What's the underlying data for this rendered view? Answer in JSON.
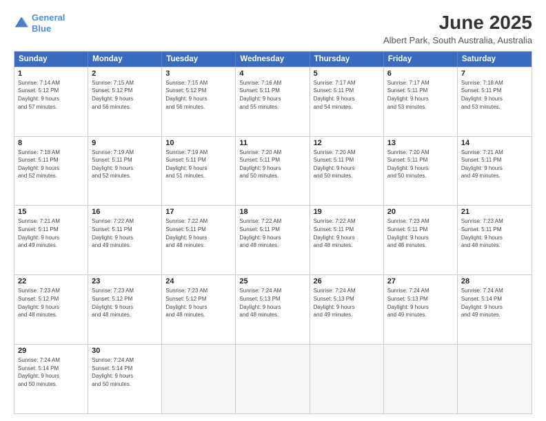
{
  "header": {
    "logo_line1": "General",
    "logo_line2": "Blue",
    "month": "June 2025",
    "location": "Albert Park, South Australia, Australia"
  },
  "days_of_week": [
    "Sunday",
    "Monday",
    "Tuesday",
    "Wednesday",
    "Thursday",
    "Friday",
    "Saturday"
  ],
  "weeks": [
    [
      {
        "day": "1",
        "info": "Sunrise: 7:14 AM\nSunset: 5:12 PM\nDaylight: 9 hours\nand 57 minutes."
      },
      {
        "day": "2",
        "info": "Sunrise: 7:15 AM\nSunset: 5:12 PM\nDaylight: 9 hours\nand 56 minutes."
      },
      {
        "day": "3",
        "info": "Sunrise: 7:15 AM\nSunset: 5:12 PM\nDaylight: 9 hours\nand 56 minutes."
      },
      {
        "day": "4",
        "info": "Sunrise: 7:16 AM\nSunset: 5:11 PM\nDaylight: 9 hours\nand 55 minutes."
      },
      {
        "day": "5",
        "info": "Sunrise: 7:17 AM\nSunset: 5:11 PM\nDaylight: 9 hours\nand 54 minutes."
      },
      {
        "day": "6",
        "info": "Sunrise: 7:17 AM\nSunset: 5:11 PM\nDaylight: 9 hours\nand 53 minutes."
      },
      {
        "day": "7",
        "info": "Sunrise: 7:18 AM\nSunset: 5:11 PM\nDaylight: 9 hours\nand 53 minutes."
      }
    ],
    [
      {
        "day": "8",
        "info": "Sunrise: 7:18 AM\nSunset: 5:11 PM\nDaylight: 9 hours\nand 52 minutes."
      },
      {
        "day": "9",
        "info": "Sunrise: 7:19 AM\nSunset: 5:11 PM\nDaylight: 9 hours\nand 52 minutes."
      },
      {
        "day": "10",
        "info": "Sunrise: 7:19 AM\nSunset: 5:11 PM\nDaylight: 9 hours\nand 51 minutes."
      },
      {
        "day": "11",
        "info": "Sunrise: 7:20 AM\nSunset: 5:11 PM\nDaylight: 9 hours\nand 50 minutes."
      },
      {
        "day": "12",
        "info": "Sunrise: 7:20 AM\nSunset: 5:11 PM\nDaylight: 9 hours\nand 50 minutes."
      },
      {
        "day": "13",
        "info": "Sunrise: 7:20 AM\nSunset: 5:11 PM\nDaylight: 9 hours\nand 50 minutes."
      },
      {
        "day": "14",
        "info": "Sunrise: 7:21 AM\nSunset: 5:11 PM\nDaylight: 9 hours\nand 49 minutes."
      }
    ],
    [
      {
        "day": "15",
        "info": "Sunrise: 7:21 AM\nSunset: 5:11 PM\nDaylight: 9 hours\nand 49 minutes."
      },
      {
        "day": "16",
        "info": "Sunrise: 7:22 AM\nSunset: 5:11 PM\nDaylight: 9 hours\nand 49 minutes."
      },
      {
        "day": "17",
        "info": "Sunrise: 7:22 AM\nSunset: 5:11 PM\nDaylight: 9 hours\nand 48 minutes."
      },
      {
        "day": "18",
        "info": "Sunrise: 7:22 AM\nSunset: 5:11 PM\nDaylight: 9 hours\nand 48 minutes."
      },
      {
        "day": "19",
        "info": "Sunrise: 7:22 AM\nSunset: 5:11 PM\nDaylight: 9 hours\nand 48 minutes."
      },
      {
        "day": "20",
        "info": "Sunrise: 7:23 AM\nSunset: 5:11 PM\nDaylight: 9 hours\nand 48 minutes."
      },
      {
        "day": "21",
        "info": "Sunrise: 7:23 AM\nSunset: 5:11 PM\nDaylight: 9 hours\nand 48 minutes."
      }
    ],
    [
      {
        "day": "22",
        "info": "Sunrise: 7:23 AM\nSunset: 5:12 PM\nDaylight: 9 hours\nand 48 minutes."
      },
      {
        "day": "23",
        "info": "Sunrise: 7:23 AM\nSunset: 5:12 PM\nDaylight: 9 hours\nand 48 minutes."
      },
      {
        "day": "24",
        "info": "Sunrise: 7:23 AM\nSunset: 5:12 PM\nDaylight: 9 hours\nand 48 minutes."
      },
      {
        "day": "25",
        "info": "Sunrise: 7:24 AM\nSunset: 5:13 PM\nDaylight: 9 hours\nand 48 minutes."
      },
      {
        "day": "26",
        "info": "Sunrise: 7:24 AM\nSunset: 5:13 PM\nDaylight: 9 hours\nand 49 minutes."
      },
      {
        "day": "27",
        "info": "Sunrise: 7:24 AM\nSunset: 5:13 PM\nDaylight: 9 hours\nand 49 minutes."
      },
      {
        "day": "28",
        "info": "Sunrise: 7:24 AM\nSunset: 5:14 PM\nDaylight: 9 hours\nand 49 minutes."
      }
    ],
    [
      {
        "day": "29",
        "info": "Sunrise: 7:24 AM\nSunset: 5:14 PM\nDaylight: 9 hours\nand 50 minutes."
      },
      {
        "day": "30",
        "info": "Sunrise: 7:24 AM\nSunset: 5:14 PM\nDaylight: 9 hours\nand 50 minutes."
      },
      {
        "day": "",
        "info": ""
      },
      {
        "day": "",
        "info": ""
      },
      {
        "day": "",
        "info": ""
      },
      {
        "day": "",
        "info": ""
      },
      {
        "day": "",
        "info": ""
      }
    ]
  ]
}
